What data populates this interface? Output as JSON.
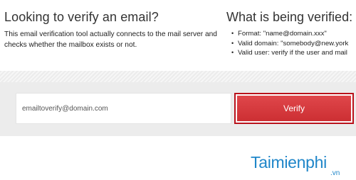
{
  "left_panel": {
    "title": "Looking to verify an email?",
    "description": "This email verification tool actually connects to the mail server and checks whether the mailbox exists or not."
  },
  "right_panel": {
    "title": "What is being verified:",
    "items": [
      "Format: \"name@domain.xxx\"",
      "Valid domain: \"somebody@new.york",
      "Valid user: verify if the user and mail"
    ]
  },
  "form": {
    "email_placeholder": "emailtoverify@domain.com",
    "verify_label": "Verify"
  },
  "watermark": {
    "brand": "Taimienphi",
    "suffix": ".vn"
  }
}
